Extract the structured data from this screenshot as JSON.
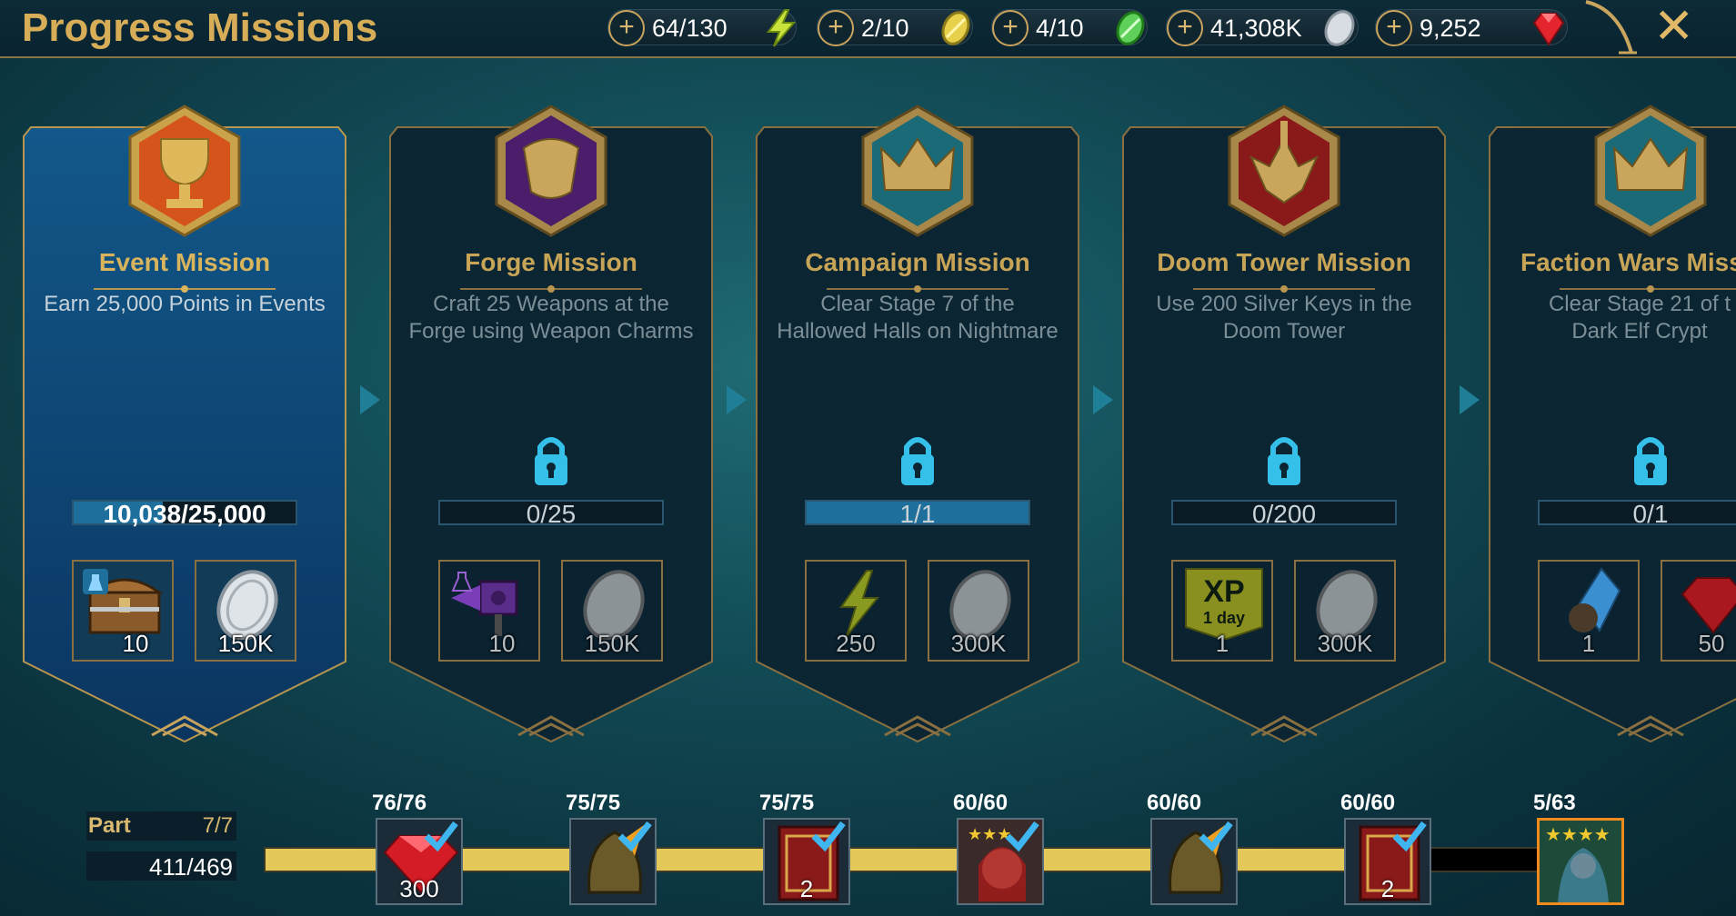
{
  "header": {
    "title": "Progress Missions",
    "resources": [
      {
        "value": "64/130",
        "icon": "energy-bolt-icon"
      },
      {
        "value": "2/10",
        "icon": "arena-token-icon"
      },
      {
        "value": "4/10",
        "icon": "tag-arena-token-icon"
      },
      {
        "value": "41,308K",
        "icon": "silver-coin-icon"
      },
      {
        "value": "9,252",
        "icon": "ruby-gem-icon"
      }
    ],
    "close_icon": "close-icon"
  },
  "missions": [
    {
      "title": "Event Mission",
      "desc": "Earn 25,000 Points in Events",
      "progress": "10,038/25,000",
      "progress_fraction": 0.4,
      "locked": false,
      "rewards": [
        {
          "icon": "chest-icon",
          "amount": "10"
        },
        {
          "icon": "silver-coin-icon",
          "amount": "150K"
        }
      ]
    },
    {
      "title": "Forge Mission",
      "desc": "Craft 25 Weapons at the Forge using Weapon Charms",
      "progress": "0/25",
      "progress_fraction": 0,
      "locked": true,
      "rewards": [
        {
          "icon": "forge-hammer-icon",
          "amount": "10"
        },
        {
          "icon": "silver-coin-icon",
          "amount": "150K"
        }
      ]
    },
    {
      "title": "Campaign Mission",
      "desc": "Clear Stage 7 of the Hallowed Halls on Nightmare",
      "progress": "1/1",
      "progress_fraction": 1,
      "locked": true,
      "rewards": [
        {
          "icon": "energy-bolt-icon",
          "amount": "250"
        },
        {
          "icon": "silver-coin-icon",
          "amount": "300K"
        }
      ]
    },
    {
      "title": "Doom Tower Mission",
      "desc": "Use 200 Silver Keys in the Doom Tower",
      "progress": "0/200",
      "progress_fraction": 0,
      "locked": true,
      "rewards": [
        {
          "icon": "xp-boost-icon",
          "amount": "1",
          "label": "XP",
          "sublabel": "1 day"
        },
        {
          "icon": "silver-coin-icon",
          "amount": "300K"
        }
      ]
    },
    {
      "title": "Faction Wars Miss",
      "desc": "Clear Stage 21 of t Dark Elf Crypt",
      "progress": "0/1",
      "progress_fraction": 0,
      "locked": true,
      "rewards": [
        {
          "icon": "shard-icon",
          "amount": "1"
        },
        {
          "icon": "ruby-gem-icon",
          "amount": "50"
        }
      ]
    }
  ],
  "footer": {
    "part_label": "Part",
    "part_value": "7/7",
    "points": "411/469",
    "points_fraction": 0.876,
    "milestones": [
      {
        "count": "76/76",
        "amount": "300",
        "icon": "ruby-gem-icon",
        "claimed": true
      },
      {
        "count": "75/75",
        "amount": "",
        "icon": "helmet-icon",
        "claimed": true
      },
      {
        "count": "75/75",
        "amount": "2",
        "icon": "tome-icon",
        "claimed": true
      },
      {
        "count": "60/60",
        "amount": "",
        "icon": "champion-portrait-icon",
        "claimed": true
      },
      {
        "count": "60/60",
        "amount": "",
        "icon": "helmet-icon",
        "claimed": true
      },
      {
        "count": "60/60",
        "amount": "2",
        "icon": "tome-icon",
        "claimed": true
      },
      {
        "count": "5/63",
        "amount": "",
        "icon": "legendary-champion-icon",
        "claimed": false
      }
    ]
  },
  "colors": {
    "gold": "#d7ad58",
    "accent_blue": "#1e6f9c",
    "track_fill": "#e4c95a",
    "final_border": "#f08a1c"
  }
}
